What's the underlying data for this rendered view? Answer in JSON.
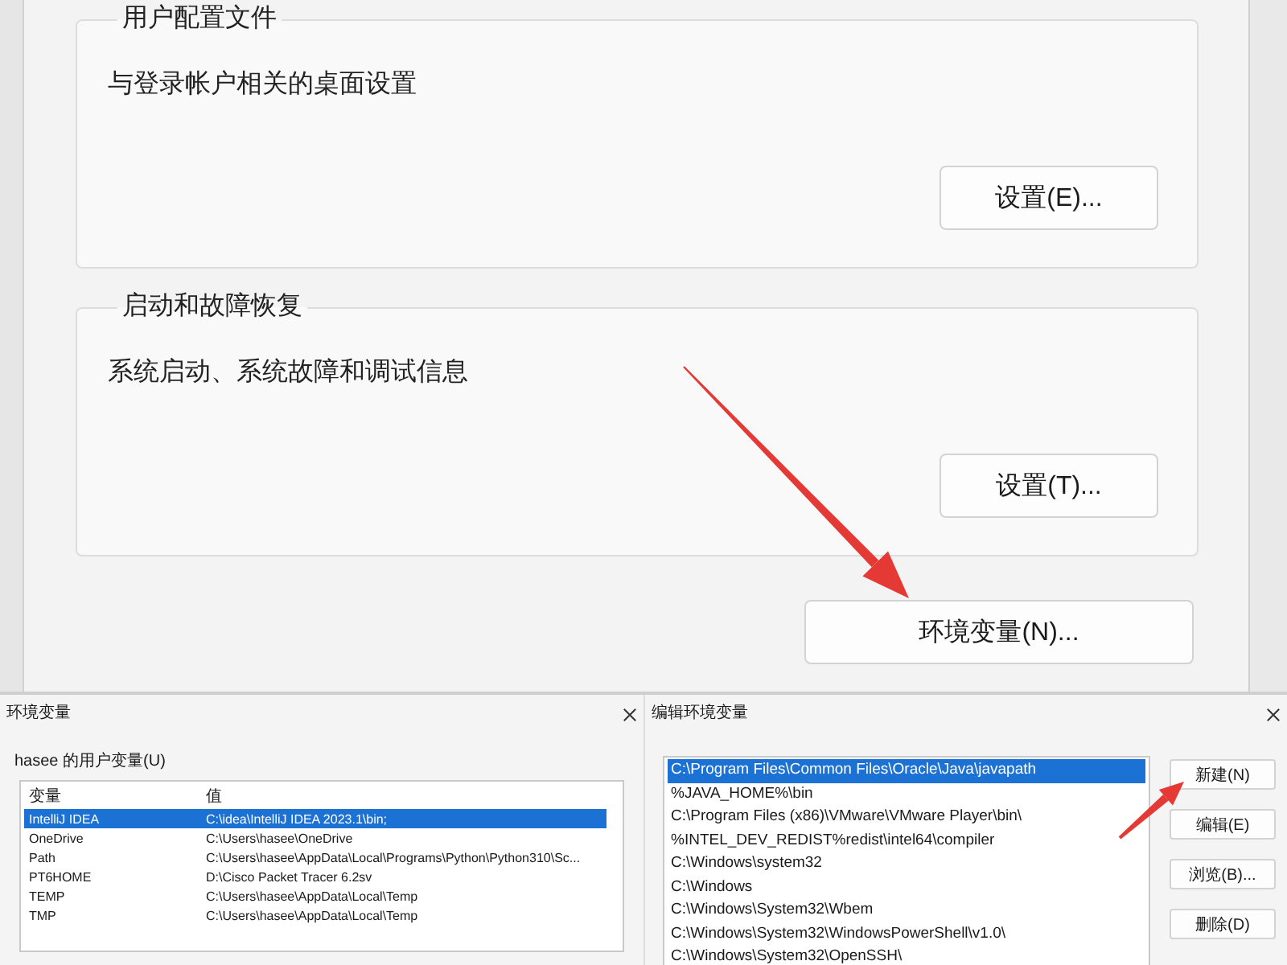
{
  "system_properties": {
    "groups": [
      {
        "title": "用户配置文件",
        "description": "与登录帐户相关的桌面设置",
        "button": "设置(E)..."
      },
      {
        "title": "启动和故障恢复",
        "description": "系统启动、系统故障和调试信息",
        "button": "设置(T)..."
      }
    ],
    "env_button": "环境变量(N)..."
  },
  "environment_variables_dialog": {
    "title": "环境变量",
    "section_label": "hasee 的用户变量(U)",
    "columns": [
      "变量",
      "值"
    ],
    "rows": [
      {
        "name": "IntelliJ IDEA",
        "value": "C:\\idea\\IntelliJ IDEA 2023.1\\bin;",
        "selected": true
      },
      {
        "name": "OneDrive",
        "value": "C:\\Users\\hasee\\OneDrive",
        "selected": false
      },
      {
        "name": "Path",
        "value": "C:\\Users\\hasee\\AppData\\Local\\Programs\\Python\\Python310\\Sc...",
        "selected": false
      },
      {
        "name": "PT6HOME",
        "value": "D:\\Cisco Packet Tracer 6.2sv",
        "selected": false
      },
      {
        "name": "TEMP",
        "value": "C:\\Users\\hasee\\AppData\\Local\\Temp",
        "selected": false
      },
      {
        "name": "TMP",
        "value": "C:\\Users\\hasee\\AppData\\Local\\Temp",
        "selected": false
      }
    ]
  },
  "edit_dialog": {
    "title": "编辑环境变量",
    "entries": [
      {
        "text": "C:\\Program Files\\Common Files\\Oracle\\Java\\javapath",
        "selected": true
      },
      {
        "text": "%JAVA_HOME%\\bin",
        "selected": false
      },
      {
        "text": "C:\\Program Files (x86)\\VMware\\VMware Player\\bin\\",
        "selected": false
      },
      {
        "text": "%INTEL_DEV_REDIST%redist\\intel64\\compiler",
        "selected": false
      },
      {
        "text": "C:\\Windows\\system32",
        "selected": false
      },
      {
        "text": "C:\\Windows",
        "selected": false
      },
      {
        "text": "C:\\Windows\\System32\\Wbem",
        "selected": false
      },
      {
        "text": "C:\\Windows\\System32\\WindowsPowerShell\\v1.0\\",
        "selected": false
      },
      {
        "text": "C:\\Windows\\System32\\OpenSSH\\",
        "selected": false
      }
    ],
    "buttons": [
      "新建(N)",
      "编辑(E)",
      "浏览(B)...",
      "删除(D)"
    ]
  }
}
